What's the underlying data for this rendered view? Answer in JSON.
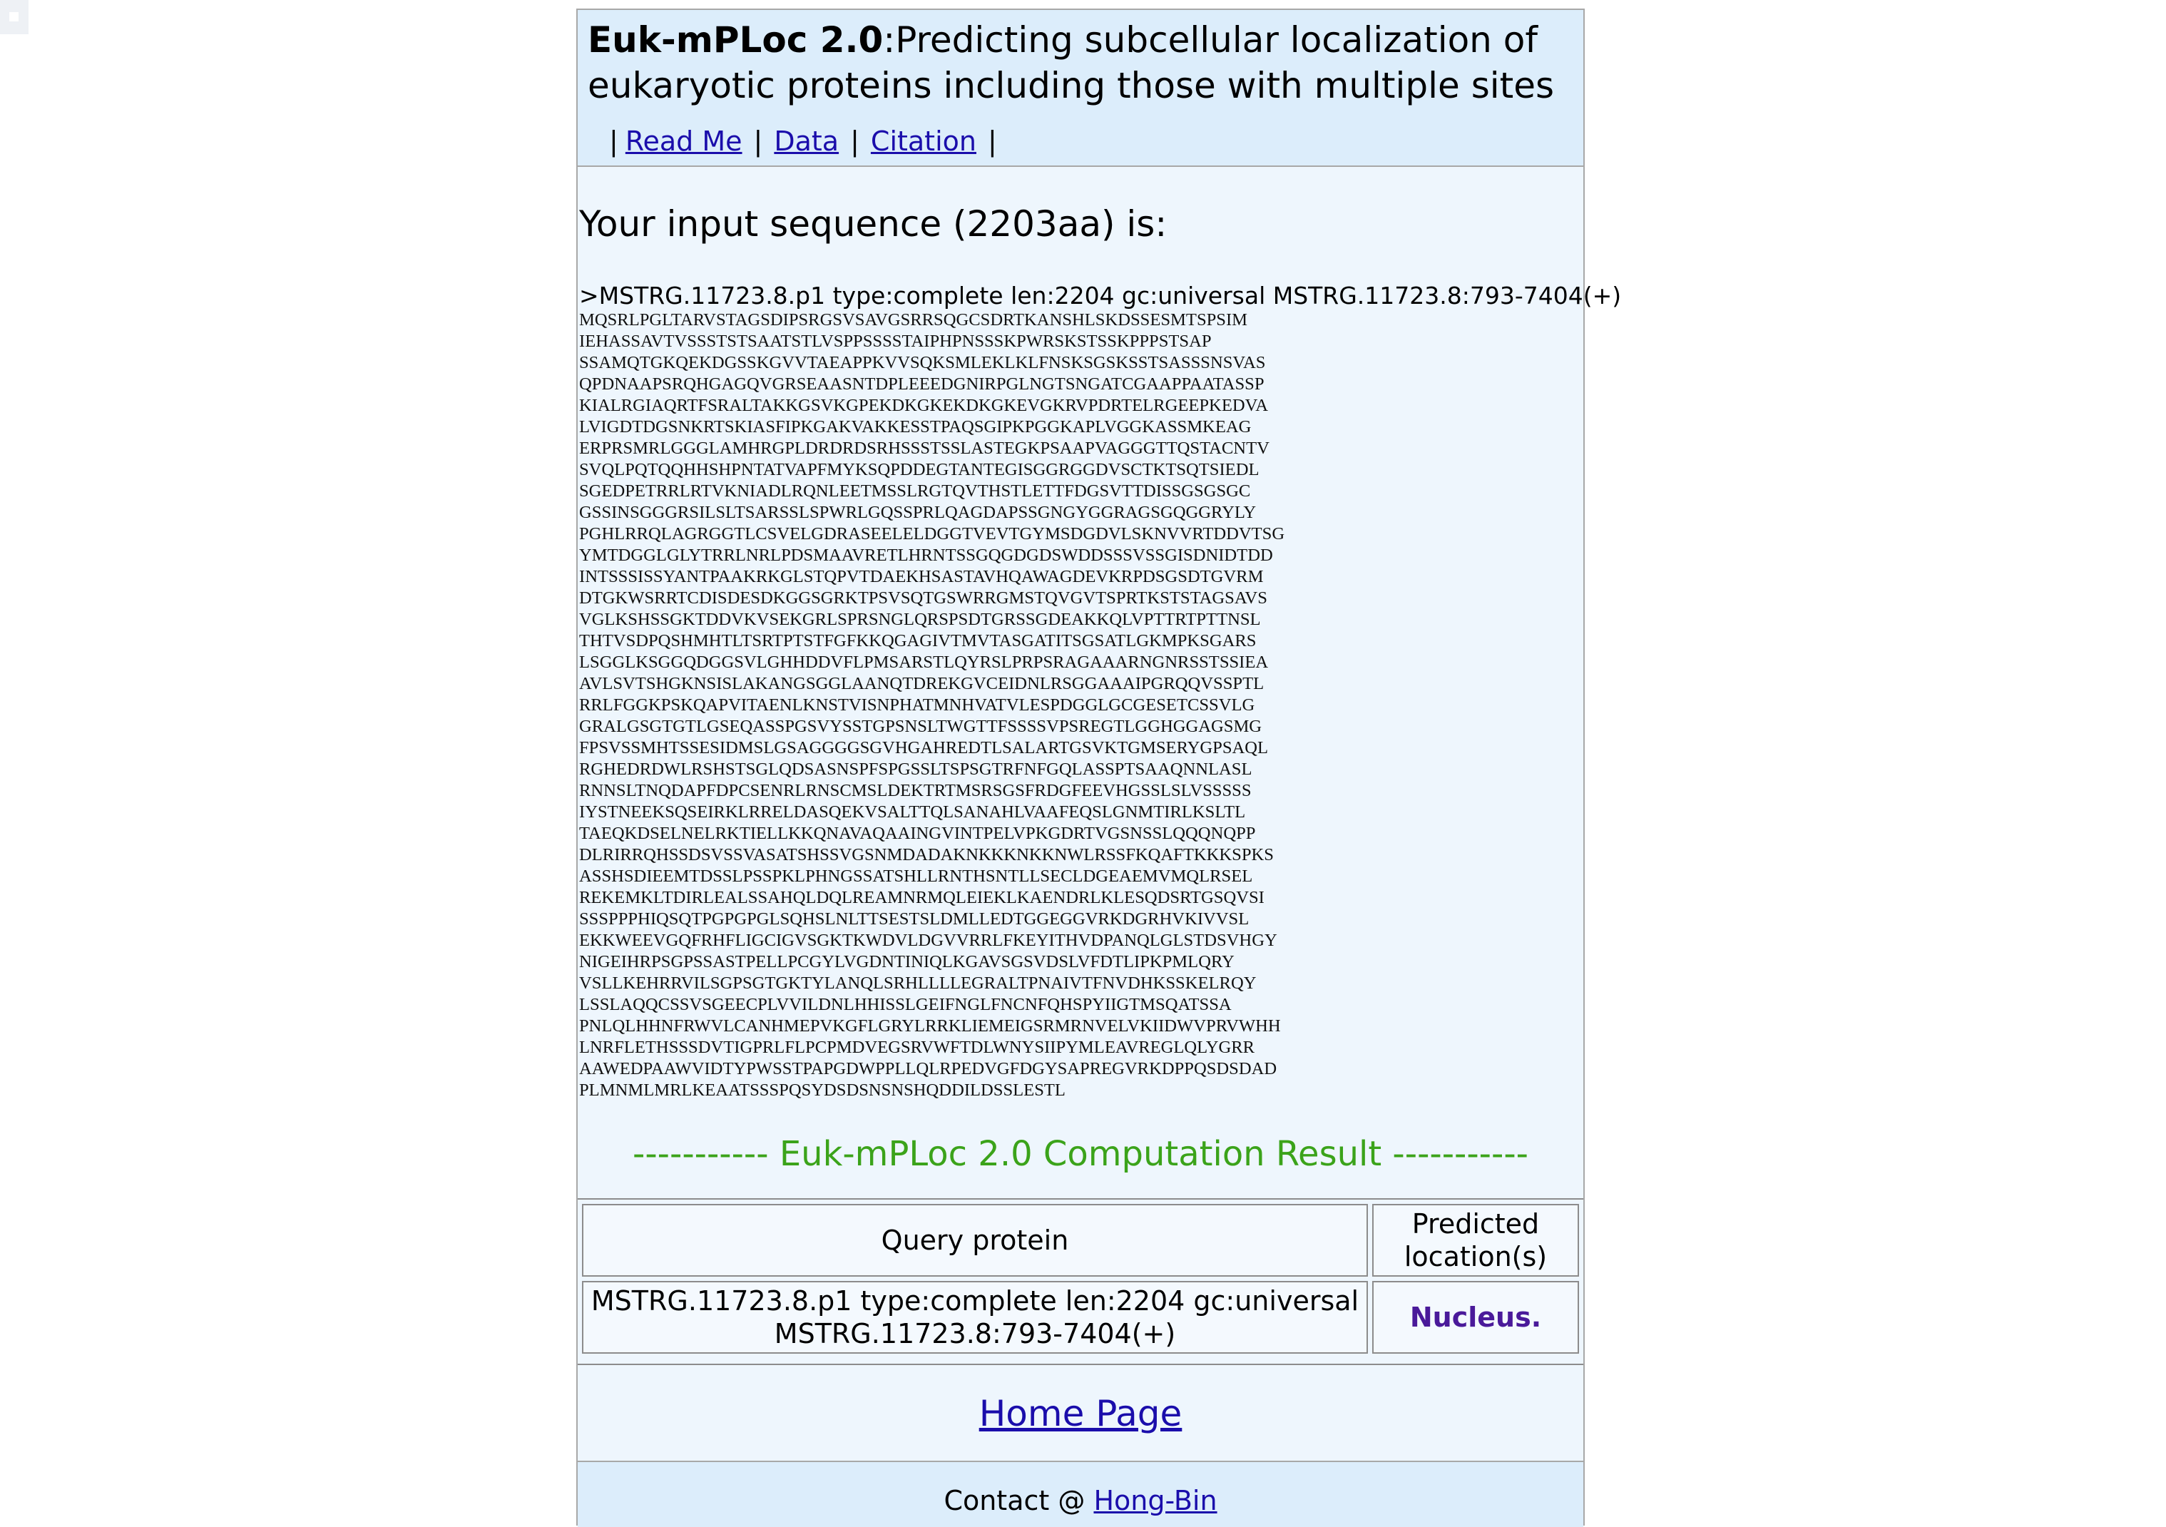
{
  "header": {
    "title_bold": "Euk-mPLoc 2.0",
    "title_rest": ":Predicting subcellular localization of eukaryotic proteins including those with multiple sites",
    "nav": {
      "readme": "Read Me",
      "data": "Data",
      "citation": "Citation",
      "separator": "|"
    }
  },
  "sequence": {
    "heading": "Your input sequence (2203aa) is:",
    "fasta_header": ">MSTRG.11723.8.p1 type:complete len:2204 gc:universal MSTRG.11723.8:793-7404(+)",
    "lines": [
      "MQSRLPGLTARVSTAGSDIPSRGSVSAVGSRRSQGCSDRTKANSHLSKDSSESMTSPSIM",
      "IEHASSAVTVSSSTSTSAATSTLVSPPSSSSTAIPHPNSSSKPWRSKSTSSKPPPSTSAP",
      "SSAMQTGKQEKDGSSKGVVTAEAPPKVVSQKSMLEKLKLFNSKSGSKSSTSASSSNSVAS",
      "QPDNAAPSRQHGAGQVGRSEAASNTDPLEEEDGNIRPGLNGTSNGATCGAAPPAATASSP",
      "KIALRGIAQRTFSRALTAKKGSVKGPEKDKGKEKDKGKEVGKRVPDRTELRGEEPKEDVA",
      "LVIGDTDGSNKRTSKIASFIPKGAKVAKKESSTPAQSGIPKPGGKAPLVGGKASSMKEAG",
      "ERPRSMRLGGGLAMHRGPLDRDRDSRHSSSTSSLASTEGKPSAAPVAGGGTTQSTACNTV",
      "SVQLPQTQQHHSHPNTATVAPFMYKSQPDDEGTANTEGISGGRGGDVSCTKTSQTSIEDL",
      "SGEDPETRRLRTVKNIADLRQNLEETMSSLRGTQVTHSTLETTFDGSVTTDISSGSGSGC",
      "GSSINSGGGRSILSLTSARSSLSPWRLGQSSPRLQAGDAPSSGNGYGGRAGSGQGGRYLY",
      "PGHLRRQLAGRGGTLCSVELGDRASEELELDGGTVEVTGYMSDGDVLSKNVVRTDDVTSG",
      "YMTDGGLGLYTRRLNRLPDSMAAVRETLHRNTSSGQGDGDSWDDSSSVSSGISDNIDTDD",
      "INTSSSISSYANTPAAKRKGLSTQPVTDAEKHSASTAVHQAWAGDEVKRPDSGSDTGVRM",
      "DTGKWSRRTCDISDESDKGGSGRKTPSVSQTGSWRRGMSTQVGVTSPRTKSTSTAGSAVS",
      "VGLKSHSSGKTDDVKVSEKGRLSPRSNGLQRSPSDTGRSSGDEAKKQLVPTTRTPTTNSL",
      "THTVSDPQSHMHTLTSRTPTSTFGFKKQGAGIVTMVTASGATITSGSATLGKMPKSGARS",
      "LSGGLKSGGQDGGSVLGHHDDVFLPMSARSTLQYRSLPRPSRAGAAARNGNRSSTSSIEA",
      "AVLSVTSHGKNSISLAKANGSGGLAANQTDREKGVCEIDNLRSGGAAAIPGRQQVSSPTL",
      "RRLFGGKPSKQAPVITAENLKNSTVISNPHATMNHVATVLESPDGGLGCGESETCSSVLG",
      "GRALGSGTGTLGSEQASSPGSVYSSTGPSNSLTWGTTFSSSSVPSREGTLGGHGGAGSMG",
      "FPSVSSMHTSSESIDMSLGSAGGGGSGVHGAHREDTLSALARTGSVKTGMSERYGPSAQL",
      "RGHEDRDWLRSHSTSGLQDSASNSPFSPGSSLTSPSGTRFNFGQLASSPTSAAQNNLASL",
      "RNNSLTNQDAPFDPCSENRLRNSCMSLDEKTRTMSRSGSFRDGFEEVHGSSLSLVSSSSS",
      "IYSTNEEKSQSEIRKLRRELDASQEKVSALTTQLSANAHLVAAFEQSLGNMTIRLKSLTL",
      "TAEQKDSELNELRKTIELLKKQNAVAQAAINGVINTPELVPKGDRTVGSNSSLQQQNQPP",
      "DLRIRRQHSSDSVSSVASATSHSSVGSNMDADAKNKKKNKKNWLRSSFKQAFTKKKSPKS",
      "ASSHSDIEEMTDSSLPSSPKLPHNGSSATSHLLRNTHSNTLLSECLDGEAEMVMQLRSEL",
      "REKEMKLTDIRLEALSSAHQLDQLREAMNRMQLEIEKLKAENDRLKLESQDSRTGSQVSI",
      "SSSPPPHIQSQTPGPGPGLSQHSLNLTTSESTSLDMLLEDTGGEGGVRKDGRHVKIVVSL",
      "EKKWEEVGQFRHFLIGCIGVSGKTKWDVLDGVVRRLFKEYITHVDPANQLGLSTDSVHGY",
      "NIGEIHRPSGPSSASTPELLPCGYLVGDNTINIQLKGAVSGSVDSLVFDTLIPKPMLQRY",
      "VSLLKEHRRVILSGPSGTGKTYLANQLSRHLLLLEGRALTPNAIVTFNVDHKSSKELRQY",
      "LSSLAQQCSSVSGEECPLVVILDNLHHISSLGEIFNGLFNCNFQHSPYIIGTMSQATSSA",
      "PNLQLHHNFRWVLCANHMEPVKGFLGRYLRRKLIEMEIGSRMRNVELVKIIDWVPRVWHH",
      "LNRFLETHSSSDVTIGPRLFLPCPMDVEGSRVWFTDLWNYSIIPYMLEAVREGLQLYGRR",
      "AAWEDPAAWVIDTYPWSSTPAPGDWPPLLQLRPEDVGFDGYSAPREGVRKDPPQSDSDAD",
      "PLMNMLMRLKEAATSSSPQSYDSDSNSNSHQDDILDSSLESTL"
    ]
  },
  "result": {
    "title": "----------- Euk-mPLoc 2.0 Computation Result -----------",
    "col_query": "Query protein",
    "col_location": "Predicted location(s)",
    "query_value": "MSTRG.11723.8.p1 type:complete len:2204 gc:universal MSTRG.11723.8:793-7404(+)",
    "location_value": "Nucleus."
  },
  "home_link": "Home Page",
  "footer": {
    "prefix": "Contact @ ",
    "link": "Hong-Bin"
  }
}
